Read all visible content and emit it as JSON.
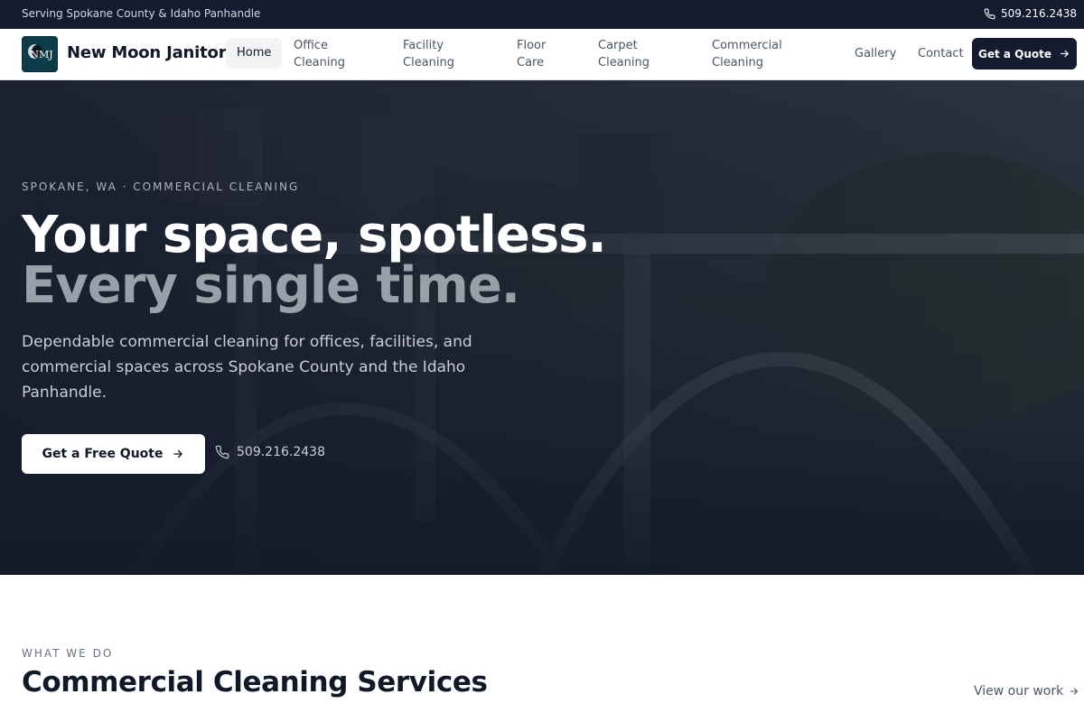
{
  "topbar": {
    "serving": "Serving Spokane County & Idaho Panhandle",
    "phone": "509.216.2438"
  },
  "nav": {
    "logo_text": "NMJ",
    "brand": "New Moon Janitorial",
    "items": [
      {
        "label": "Home",
        "active": true
      },
      {
        "label": "Office Cleaning"
      },
      {
        "label": "Facility Cleaning"
      },
      {
        "label": "Floor Care"
      },
      {
        "label": "Carpet Cleaning"
      },
      {
        "label": "Commercial Cleaning"
      },
      {
        "label": "Gallery"
      },
      {
        "label": "Contact"
      }
    ],
    "cta": "Get a Quote"
  },
  "hero": {
    "eyebrow": "SPOKANE, WA · COMMERCIAL CLEANING",
    "headline_1": "Your space, spotless.",
    "headline_2": "Every single time.",
    "lead": "Dependable commercial cleaning for offices, facilities, and commercial spaces across Spokane County and the Idaho Panhandle.",
    "cta": "Get a Free Quote",
    "phone": "509.216.2438"
  },
  "services": {
    "eyebrow": "WHAT WE DO",
    "title": "Commercial Cleaning Services",
    "view_link": "View our work"
  },
  "colors": {
    "dark": "#141b2e",
    "white": "#ffffff",
    "muted_headline": "#9aa0a9"
  },
  "icons": {
    "phone": "phone-icon",
    "arrow": "arrow-right-icon"
  }
}
